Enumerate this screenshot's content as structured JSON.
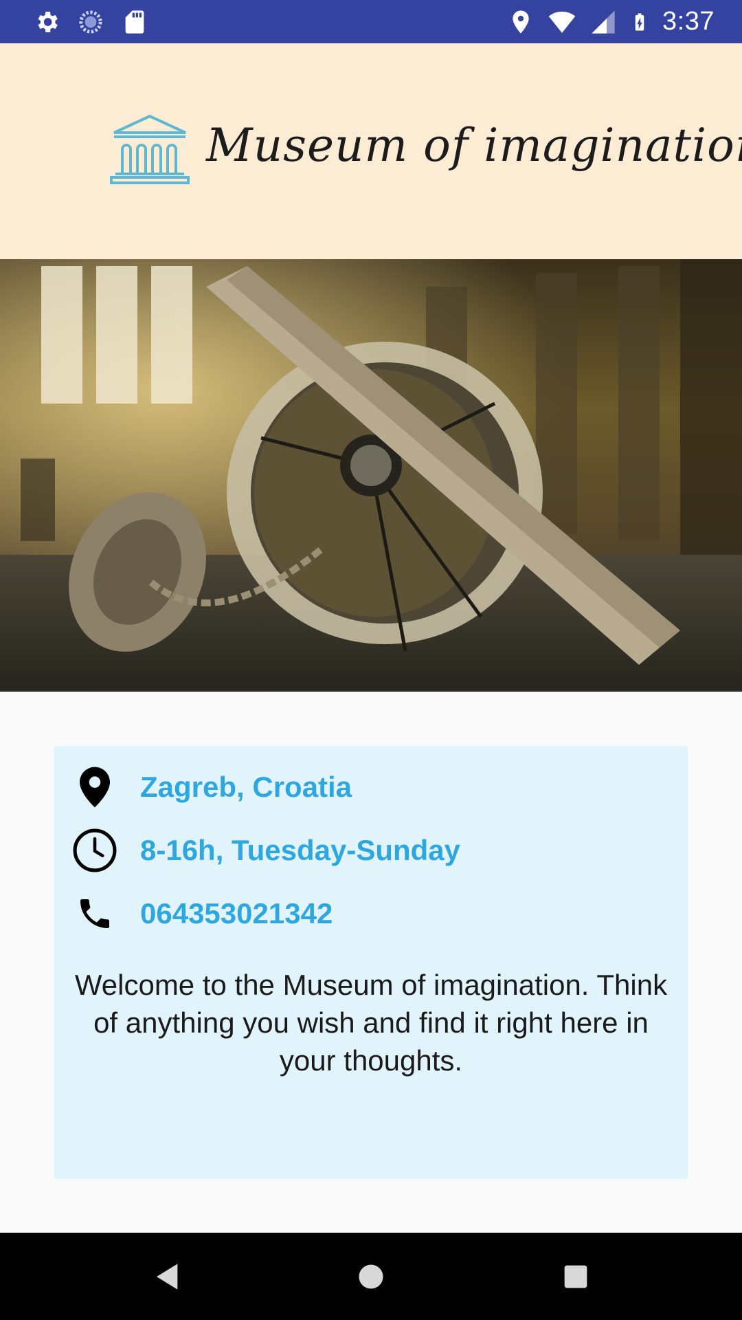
{
  "status_bar": {
    "time": "3:37",
    "icons_left": [
      "settings-icon",
      "sync-icon",
      "sd-card-icon"
    ],
    "icons_right": [
      "location-icon",
      "wifi-icon",
      "cell-signal-icon",
      "battery-charging-icon"
    ],
    "background": "#3442a0"
  },
  "header": {
    "logo_icon": "museum-building-icon",
    "logo_text": "Museum of imagination",
    "background": "#fdecd4",
    "logo_icon_color": "#5fb8d0"
  },
  "hero": {
    "icon": "vintage-lamp-photo"
  },
  "info": {
    "location": "Zagreb, Croatia",
    "hours": "8-16h, Tuesday-Sunday",
    "phone": "064353021342",
    "welcome": "Welcome to the Museum of imagination. Think of anything you wish and find it right here in your thoughts.",
    "accent_color": "#2ea7e0",
    "card_background": "#e1f4fc"
  },
  "nav_bar": {
    "buttons": [
      "back-icon",
      "home-icon",
      "recents-icon"
    ]
  }
}
